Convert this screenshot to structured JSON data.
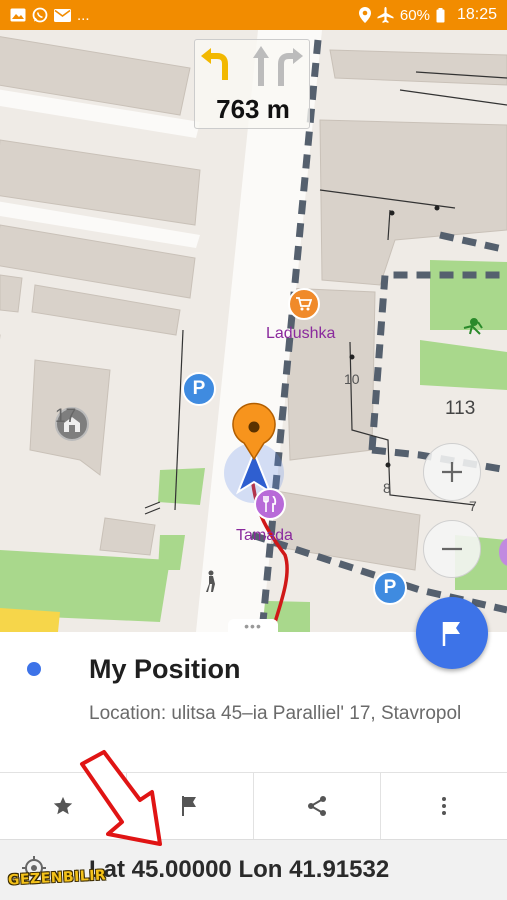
{
  "status_bar": {
    "left_icons": [
      "image-icon",
      "whatsapp-icon",
      "mail-icon"
    ],
    "overflow": "...",
    "right_icons": [
      "location-icon",
      "airplane-icon"
    ],
    "battery": "60%",
    "time": "18:25"
  },
  "map": {
    "turn_distance": "763 m",
    "pois": {
      "shop_label": "Ladushka",
      "restaurant_label": "Tamada",
      "parking_glyph": "P",
      "monument_num": "17"
    },
    "house_numbers": [
      "10",
      "8",
      "7"
    ],
    "building_number": "113",
    "zoom_in": "+",
    "zoom_out": "−"
  },
  "sheet": {
    "handle": "•••",
    "title": "My Position",
    "address": "Location: ulitsa 45–ia Paralliel' 17, Stavropol",
    "actions": [
      "star-icon",
      "flag-icon",
      "share-icon",
      "more-icon"
    ],
    "coordinates": "Lat 45.00000 Lon 41.91532"
  },
  "watermark": "GEZENBILIR",
  "colors": {
    "status_bar": "#f28c00",
    "accent_blue": "#3d73e8",
    "route": "#d01818",
    "poi_purple": "#8a2a9d"
  }
}
